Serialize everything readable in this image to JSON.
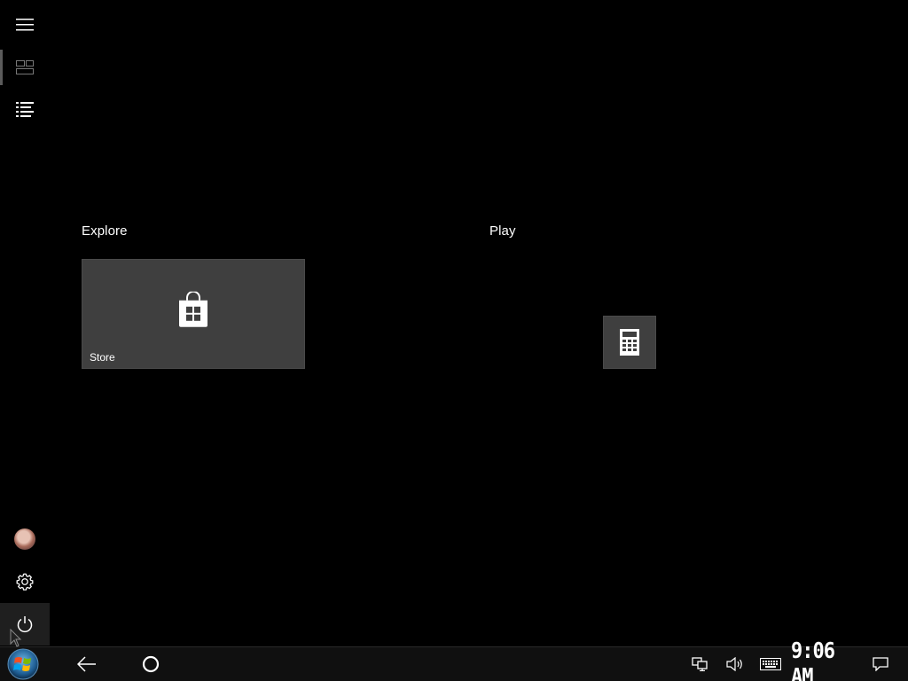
{
  "rail": {
    "menu_icon": "hamburger-menu-icon",
    "pinned_tiles_icon": "tiles-view-icon",
    "all_apps_icon": "all-apps-list-icon",
    "user_icon": "user-avatar",
    "settings_icon": "gear-icon",
    "power_icon": "power-icon"
  },
  "groups": [
    {
      "title": "Explore",
      "tiles": [
        {
          "label": "Store",
          "icon": "store-bag-icon"
        }
      ]
    },
    {
      "title": "Play",
      "tiles": [
        {
          "label": "",
          "icon": "calculator-icon"
        }
      ]
    }
  ],
  "taskbar": {
    "start_icon": "windows-start-orb-icon",
    "back_icon": "back-arrow-icon",
    "search_icon": "cortana-circle-icon",
    "network_icon": "network-icon",
    "volume_icon": "volume-icon",
    "keyboard_icon": "touch-keyboard-icon",
    "clock": "9:06 AM",
    "notifications_icon": "action-center-icon"
  },
  "colors": {
    "background": "#000000",
    "tile": "#3f3f3f",
    "taskbar": "#101010"
  }
}
